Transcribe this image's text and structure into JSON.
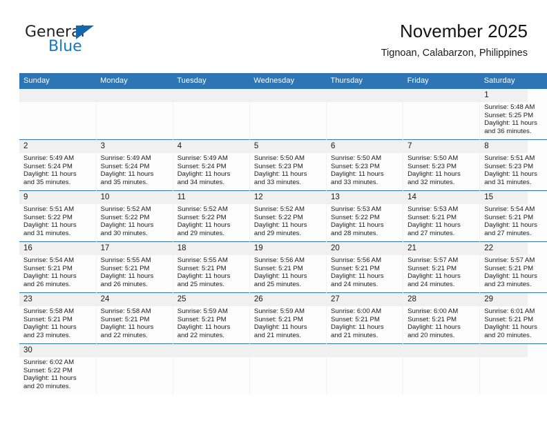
{
  "logo": {
    "name": "general-blue-logo",
    "text_top": "General",
    "text_bottom": "Blue",
    "color_dark": "#231f20",
    "color_blue": "#1479c4",
    "triangle_color": "#1466ad"
  },
  "header": {
    "title": "November 2025",
    "subtitle": "Tignoan, Calabarzon, Philippines"
  },
  "theme": {
    "header_blue": "#2e75b6",
    "band_gray": "#f0f0f0",
    "cell_bg": "#fdfdfd",
    "text": "#1a1a1a"
  },
  "weekday_headers": [
    "Sunday",
    "Monday",
    "Tuesday",
    "Wednesday",
    "Thursday",
    "Friday",
    "Saturday"
  ],
  "labels": {
    "sunrise_prefix": "Sunrise:",
    "sunset_prefix": "Sunset:",
    "daylight_prefix": "Daylight:"
  },
  "weeks": [
    [
      {
        "day": "",
        "empty": true,
        "lines": []
      },
      {
        "day": "",
        "empty": true,
        "lines": []
      },
      {
        "day": "",
        "empty": true,
        "lines": []
      },
      {
        "day": "",
        "empty": true,
        "lines": []
      },
      {
        "day": "",
        "empty": true,
        "lines": []
      },
      {
        "day": "",
        "empty": true,
        "lines": []
      },
      {
        "day": "1",
        "empty": false,
        "sunrise": "5:48 AM",
        "sunset": "5:25 PM",
        "daylight": "11 hours and 36 minutes.",
        "lines": [
          "Sunrise: 5:48 AM",
          "Sunset: 5:25 PM",
          "Daylight: 11 hours",
          "and 36 minutes."
        ]
      }
    ],
    [
      {
        "day": "2",
        "empty": false,
        "sunrise": "5:49 AM",
        "sunset": "5:24 PM",
        "daylight": "11 hours and 35 minutes.",
        "lines": [
          "Sunrise: 5:49 AM",
          "Sunset: 5:24 PM",
          "Daylight: 11 hours",
          "and 35 minutes."
        ]
      },
      {
        "day": "3",
        "empty": false,
        "sunrise": "5:49 AM",
        "sunset": "5:24 PM",
        "daylight": "11 hours and 35 minutes.",
        "lines": [
          "Sunrise: 5:49 AM",
          "Sunset: 5:24 PM",
          "Daylight: 11 hours",
          "and 35 minutes."
        ]
      },
      {
        "day": "4",
        "empty": false,
        "sunrise": "5:49 AM",
        "sunset": "5:24 PM",
        "daylight": "11 hours and 34 minutes.",
        "lines": [
          "Sunrise: 5:49 AM",
          "Sunset: 5:24 PM",
          "Daylight: 11 hours",
          "and 34 minutes."
        ]
      },
      {
        "day": "5",
        "empty": false,
        "sunrise": "5:50 AM",
        "sunset": "5:23 PM",
        "daylight": "11 hours and 33 minutes.",
        "lines": [
          "Sunrise: 5:50 AM",
          "Sunset: 5:23 PM",
          "Daylight: 11 hours",
          "and 33 minutes."
        ]
      },
      {
        "day": "6",
        "empty": false,
        "sunrise": "5:50 AM",
        "sunset": "5:23 PM",
        "daylight": "11 hours and 33 minutes.",
        "lines": [
          "Sunrise: 5:50 AM",
          "Sunset: 5:23 PM",
          "Daylight: 11 hours",
          "and 33 minutes."
        ]
      },
      {
        "day": "7",
        "empty": false,
        "sunrise": "5:50 AM",
        "sunset": "5:23 PM",
        "daylight": "11 hours and 32 minutes.",
        "lines": [
          "Sunrise: 5:50 AM",
          "Sunset: 5:23 PM",
          "Daylight: 11 hours",
          "and 32 minutes."
        ]
      },
      {
        "day": "8",
        "empty": false,
        "sunrise": "5:51 AM",
        "sunset": "5:23 PM",
        "daylight": "11 hours and 31 minutes.",
        "lines": [
          "Sunrise: 5:51 AM",
          "Sunset: 5:23 PM",
          "Daylight: 11 hours",
          "and 31 minutes."
        ]
      }
    ],
    [
      {
        "day": "9",
        "empty": false,
        "sunrise": "5:51 AM",
        "sunset": "5:22 PM",
        "daylight": "11 hours and 31 minutes.",
        "lines": [
          "Sunrise: 5:51 AM",
          "Sunset: 5:22 PM",
          "Daylight: 11 hours",
          "and 31 minutes."
        ]
      },
      {
        "day": "10",
        "empty": false,
        "sunrise": "5:52 AM",
        "sunset": "5:22 PM",
        "daylight": "11 hours and 30 minutes.",
        "lines": [
          "Sunrise: 5:52 AM",
          "Sunset: 5:22 PM",
          "Daylight: 11 hours",
          "and 30 minutes."
        ]
      },
      {
        "day": "11",
        "empty": false,
        "sunrise": "5:52 AM",
        "sunset": "5:22 PM",
        "daylight": "11 hours and 29 minutes.",
        "lines": [
          "Sunrise: 5:52 AM",
          "Sunset: 5:22 PM",
          "Daylight: 11 hours",
          "and 29 minutes."
        ]
      },
      {
        "day": "12",
        "empty": false,
        "sunrise": "5:52 AM",
        "sunset": "5:22 PM",
        "daylight": "11 hours and 29 minutes.",
        "lines": [
          "Sunrise: 5:52 AM",
          "Sunset: 5:22 PM",
          "Daylight: 11 hours",
          "and 29 minutes."
        ]
      },
      {
        "day": "13",
        "empty": false,
        "sunrise": "5:53 AM",
        "sunset": "5:22 PM",
        "daylight": "11 hours and 28 minutes.",
        "lines": [
          "Sunrise: 5:53 AM",
          "Sunset: 5:22 PM",
          "Daylight: 11 hours",
          "and 28 minutes."
        ]
      },
      {
        "day": "14",
        "empty": false,
        "sunrise": "5:53 AM",
        "sunset": "5:21 PM",
        "daylight": "11 hours and 27 minutes.",
        "lines": [
          "Sunrise: 5:53 AM",
          "Sunset: 5:21 PM",
          "Daylight: 11 hours",
          "and 27 minutes."
        ]
      },
      {
        "day": "15",
        "empty": false,
        "sunrise": "5:54 AM",
        "sunset": "5:21 PM",
        "daylight": "11 hours and 27 minutes.",
        "lines": [
          "Sunrise: 5:54 AM",
          "Sunset: 5:21 PM",
          "Daylight: 11 hours",
          "and 27 minutes."
        ]
      }
    ],
    [
      {
        "day": "16",
        "empty": false,
        "sunrise": "5:54 AM",
        "sunset": "5:21 PM",
        "daylight": "11 hours and 26 minutes.",
        "lines": [
          "Sunrise: 5:54 AM",
          "Sunset: 5:21 PM",
          "Daylight: 11 hours",
          "and 26 minutes."
        ]
      },
      {
        "day": "17",
        "empty": false,
        "sunrise": "5:55 AM",
        "sunset": "5:21 PM",
        "daylight": "11 hours and 26 minutes.",
        "lines": [
          "Sunrise: 5:55 AM",
          "Sunset: 5:21 PM",
          "Daylight: 11 hours",
          "and 26 minutes."
        ]
      },
      {
        "day": "18",
        "empty": false,
        "sunrise": "5:55 AM",
        "sunset": "5:21 PM",
        "daylight": "11 hours and 25 minutes.",
        "lines": [
          "Sunrise: 5:55 AM",
          "Sunset: 5:21 PM",
          "Daylight: 11 hours",
          "and 25 minutes."
        ]
      },
      {
        "day": "19",
        "empty": false,
        "sunrise": "5:56 AM",
        "sunset": "5:21 PM",
        "daylight": "11 hours and 25 minutes.",
        "lines": [
          "Sunrise: 5:56 AM",
          "Sunset: 5:21 PM",
          "Daylight: 11 hours",
          "and 25 minutes."
        ]
      },
      {
        "day": "20",
        "empty": false,
        "sunrise": "5:56 AM",
        "sunset": "5:21 PM",
        "daylight": "11 hours and 24 minutes.",
        "lines": [
          "Sunrise: 5:56 AM",
          "Sunset: 5:21 PM",
          "Daylight: 11 hours",
          "and 24 minutes."
        ]
      },
      {
        "day": "21",
        "empty": false,
        "sunrise": "5:57 AM",
        "sunset": "5:21 PM",
        "daylight": "11 hours and 24 minutes.",
        "lines": [
          "Sunrise: 5:57 AM",
          "Sunset: 5:21 PM",
          "Daylight: 11 hours",
          "and 24 minutes."
        ]
      },
      {
        "day": "22",
        "empty": false,
        "sunrise": "5:57 AM",
        "sunset": "5:21 PM",
        "daylight": "11 hours and 23 minutes.",
        "lines": [
          "Sunrise: 5:57 AM",
          "Sunset: 5:21 PM",
          "Daylight: 11 hours",
          "and 23 minutes."
        ]
      }
    ],
    [
      {
        "day": "23",
        "empty": false,
        "sunrise": "5:58 AM",
        "sunset": "5:21 PM",
        "daylight": "11 hours and 23 minutes.",
        "lines": [
          "Sunrise: 5:58 AM",
          "Sunset: 5:21 PM",
          "Daylight: 11 hours",
          "and 23 minutes."
        ]
      },
      {
        "day": "24",
        "empty": false,
        "sunrise": "5:58 AM",
        "sunset": "5:21 PM",
        "daylight": "11 hours and 22 minutes.",
        "lines": [
          "Sunrise: 5:58 AM",
          "Sunset: 5:21 PM",
          "Daylight: 11 hours",
          "and 22 minutes."
        ]
      },
      {
        "day": "25",
        "empty": false,
        "sunrise": "5:59 AM",
        "sunset": "5:21 PM",
        "daylight": "11 hours and 22 minutes.",
        "lines": [
          "Sunrise: 5:59 AM",
          "Sunset: 5:21 PM",
          "Daylight: 11 hours",
          "and 22 minutes."
        ]
      },
      {
        "day": "26",
        "empty": false,
        "sunrise": "5:59 AM",
        "sunset": "5:21 PM",
        "daylight": "11 hours and 21 minutes.",
        "lines": [
          "Sunrise: 5:59 AM",
          "Sunset: 5:21 PM",
          "Daylight: 11 hours",
          "and 21 minutes."
        ]
      },
      {
        "day": "27",
        "empty": false,
        "sunrise": "6:00 AM",
        "sunset": "5:21 PM",
        "daylight": "11 hours and 21 minutes.",
        "lines": [
          "Sunrise: 6:00 AM",
          "Sunset: 5:21 PM",
          "Daylight: 11 hours",
          "and 21 minutes."
        ]
      },
      {
        "day": "28",
        "empty": false,
        "sunrise": "6:00 AM",
        "sunset": "5:21 PM",
        "daylight": "11 hours and 20 minutes.",
        "lines": [
          "Sunrise: 6:00 AM",
          "Sunset: 5:21 PM",
          "Daylight: 11 hours",
          "and 20 minutes."
        ]
      },
      {
        "day": "29",
        "empty": false,
        "sunrise": "6:01 AM",
        "sunset": "5:21 PM",
        "daylight": "11 hours and 20 minutes.",
        "lines": [
          "Sunrise: 6:01 AM",
          "Sunset: 5:21 PM",
          "Daylight: 11 hours",
          "and 20 minutes."
        ]
      }
    ],
    [
      {
        "day": "30",
        "empty": false,
        "sunrise": "6:02 AM",
        "sunset": "5:22 PM",
        "daylight": "11 hours and 20 minutes.",
        "lines": [
          "Sunrise: 6:02 AM",
          "Sunset: 5:22 PM",
          "Daylight: 11 hours",
          "and 20 minutes."
        ]
      },
      {
        "day": "",
        "empty": true,
        "lines": []
      },
      {
        "day": "",
        "empty": true,
        "lines": []
      },
      {
        "day": "",
        "empty": true,
        "lines": []
      },
      {
        "day": "",
        "empty": true,
        "lines": []
      },
      {
        "day": "",
        "empty": true,
        "lines": []
      },
      {
        "day": "",
        "empty": true,
        "lines": []
      }
    ]
  ]
}
